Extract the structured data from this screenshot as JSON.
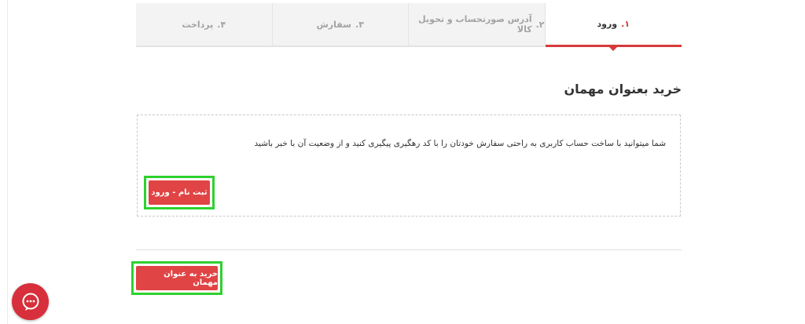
{
  "steps": [
    {
      "num": "۴.",
      "label": "پرداخت",
      "active": false
    },
    {
      "num": "۳.",
      "label": "سفارش",
      "active": false
    },
    {
      "num": "۲.",
      "label": "آدرس صورتحساب و تحویل کالا",
      "active": false
    },
    {
      "num": "۱.",
      "label": "ورود",
      "active": true
    }
  ],
  "guest": {
    "title": "خرید بعنوان مهمان",
    "info": "شما میتوانید با ساخت حساب کاربری به راحتی سفارش خودتان را با کد رهگیری پیگیری کنید و از وضعیت آن با خبر باشید",
    "register_label": "ثبت نام - ورود",
    "guest_checkout_label": "خرید به عنوان مهمان"
  },
  "colors": {
    "accent": "#d83a3a",
    "button": "#e04444",
    "highlight": "#2ed12e",
    "chat": "#d72f3b"
  },
  "icons": {
    "chat": "chat-bubble-icon"
  }
}
